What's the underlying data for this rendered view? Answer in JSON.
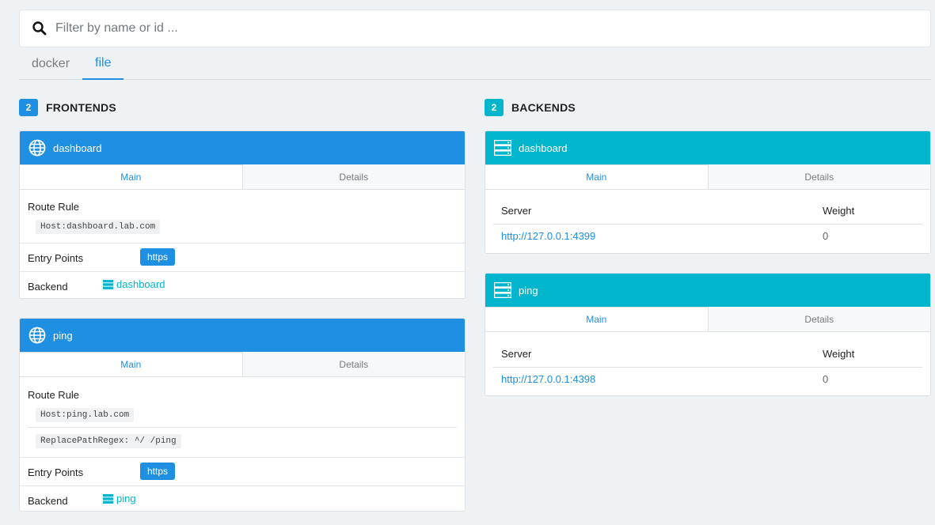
{
  "search": {
    "placeholder": "Filter by name or id ..."
  },
  "providers": {
    "tabs": [
      {
        "label": "docker"
      },
      {
        "label": "file"
      }
    ],
    "active": "file"
  },
  "frontends": {
    "count": "2",
    "title": "FRONTENDS",
    "items": [
      {
        "name": "dashboard",
        "tabs": {
          "main": "Main",
          "details": "Details"
        },
        "route_rule_label": "Route Rule",
        "rules": [
          "Host:dashboard.lab.com"
        ],
        "entry_points_label": "Entry Points",
        "entry_points": [
          "https"
        ],
        "backend_label": "Backend",
        "backend": "dashboard"
      },
      {
        "name": "ping",
        "tabs": {
          "main": "Main",
          "details": "Details"
        },
        "route_rule_label": "Route Rule",
        "rules": [
          "Host:ping.lab.com",
          "ReplacePathRegex: ^/ /ping"
        ],
        "entry_points_label": "Entry Points",
        "entry_points": [
          "https"
        ],
        "backend_label": "Backend",
        "backend": "ping"
      }
    ]
  },
  "backends": {
    "count": "2",
    "title": "BACKENDS",
    "items": [
      {
        "name": "dashboard",
        "tabs": {
          "main": "Main",
          "details": "Details"
        },
        "columns": {
          "server": "Server",
          "weight": "Weight"
        },
        "servers": [
          {
            "url": "http://127.0.0.1:4399",
            "weight": "0"
          }
        ]
      },
      {
        "name": "ping",
        "tabs": {
          "main": "Main",
          "details": "Details"
        },
        "columns": {
          "server": "Server",
          "weight": "Weight"
        },
        "servers": [
          {
            "url": "http://127.0.0.1:4398",
            "weight": "0"
          }
        ]
      }
    ]
  },
  "colors": {
    "accent": "#1e8fe1",
    "backend": "#01b5cc",
    "background": "#eff2f5"
  },
  "icons": {
    "search": "search-icon",
    "frontend": "globe-icon",
    "backend": "server-icon"
  }
}
